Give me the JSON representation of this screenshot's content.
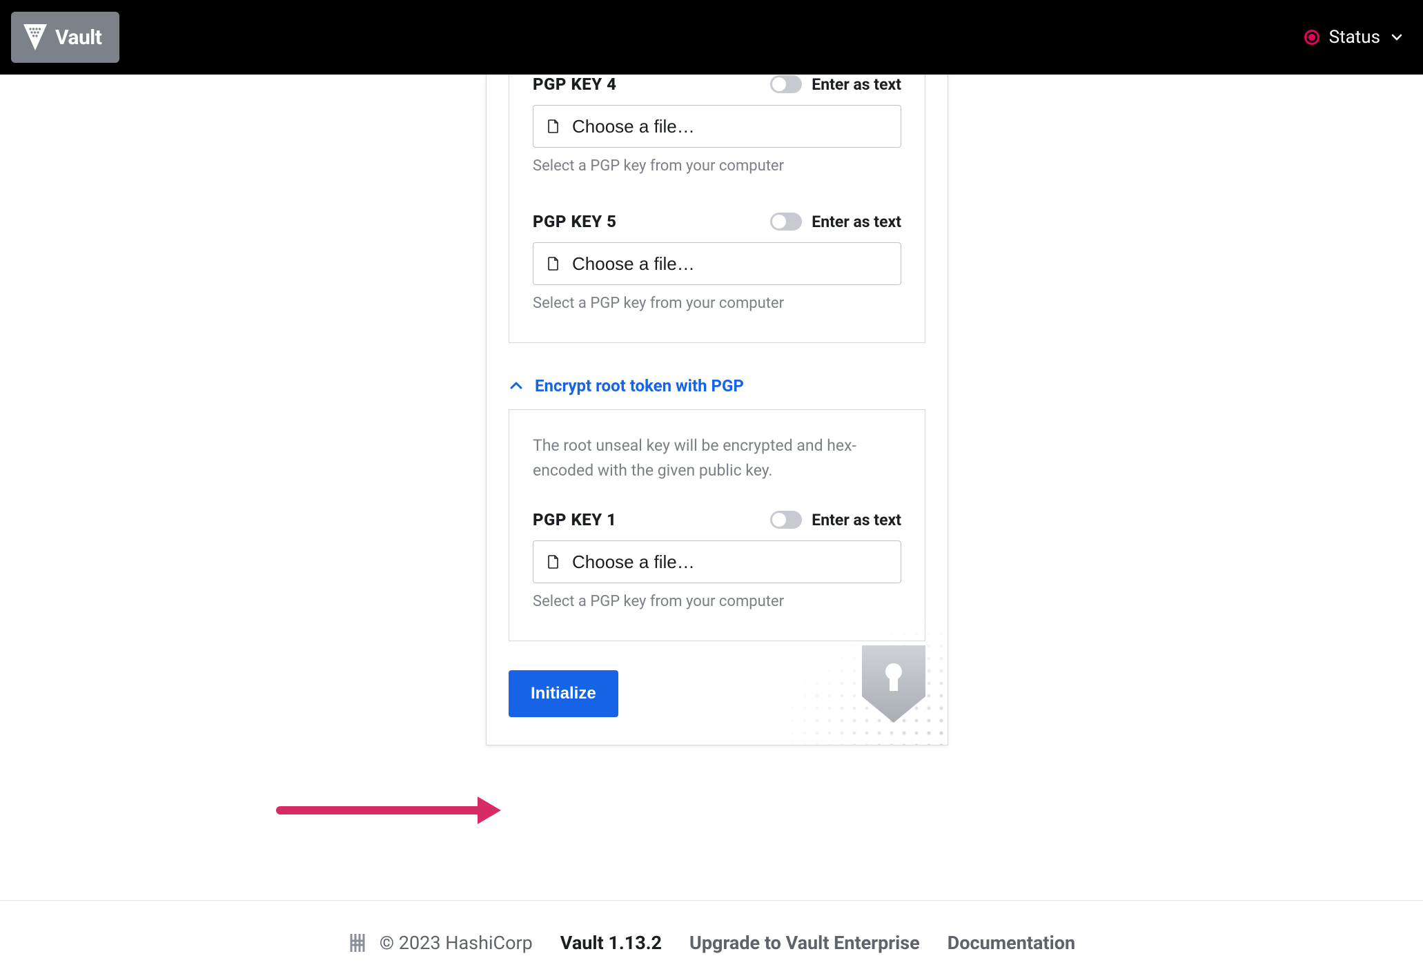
{
  "navbar": {
    "brand": "Vault",
    "status_label": "Status"
  },
  "keys_section": {
    "keys": [
      {
        "label": "PGP KEY 4",
        "toggle_label": "Enter as text",
        "file_label": "Choose a file…",
        "helper": "Select a PGP key from your computer"
      },
      {
        "label": "PGP KEY 5",
        "toggle_label": "Enter as text",
        "file_label": "Choose a file…",
        "helper": "Select a PGP key from your computer"
      }
    ]
  },
  "root_section": {
    "collapse_label": "Encrypt root token with PGP",
    "description": "The root unseal key will be encrypted and hex-encoded with the given public key.",
    "key": {
      "label": "PGP KEY 1",
      "toggle_label": "Enter as text",
      "file_label": "Choose a file…",
      "helper": "Select a PGP key from your computer"
    }
  },
  "actions": {
    "initialize": "Initialize"
  },
  "footer": {
    "copyright": "© 2023 HashiCorp",
    "version": "Vault 1.13.2",
    "upgrade": "Upgrade to Vault Enterprise",
    "docs": "Documentation"
  }
}
